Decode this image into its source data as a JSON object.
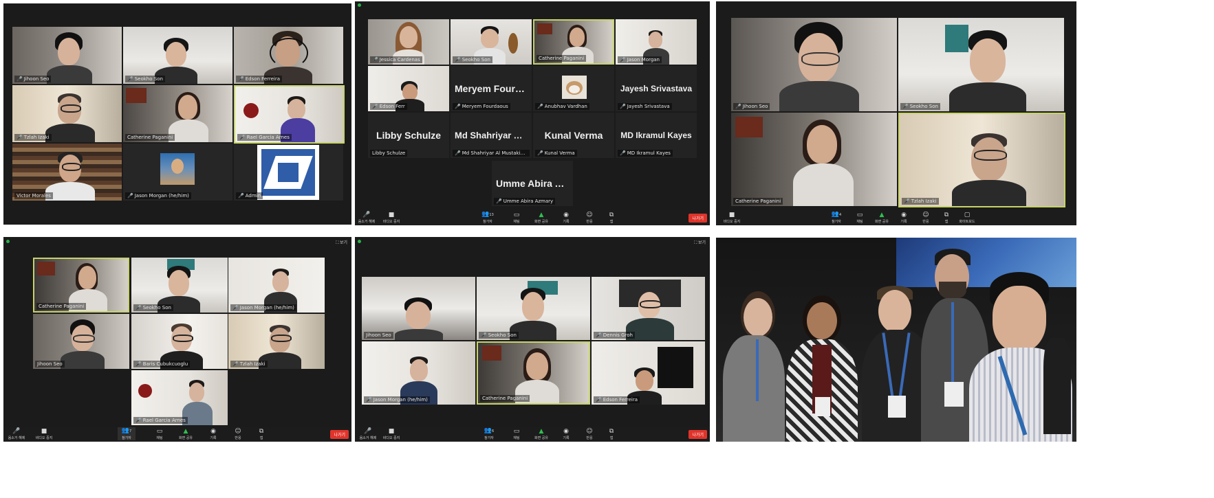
{
  "panels": {
    "p1": {
      "tiles": [
        {
          "name": "Jihoon Seo"
        },
        {
          "name": "Seokho Son"
        },
        {
          "name": "Edson Ferreira"
        },
        {
          "name": "Tzlah Izaki"
        },
        {
          "name": "Catherine Paganini"
        },
        {
          "name": "Rael Garcia Arnes"
        },
        {
          "name": "Victor Morales"
        },
        {
          "name": "Jason Morgan (he/him)"
        },
        {
          "name": "Admin"
        }
      ]
    },
    "p2": {
      "tiles": [
        {
          "name": "Jessica Cardenas",
          "big": ""
        },
        {
          "name": "Seokho Son",
          "big": ""
        },
        {
          "name": "Catherine Paganini",
          "big": ""
        },
        {
          "name": "Jason Morgan",
          "big": ""
        },
        {
          "name": "Edson Ferr",
          "big": ""
        },
        {
          "name": "Meryem Fourdaous",
          "big": "Meryem Fourda..."
        },
        {
          "name": "Anubhav Vardhan",
          "big": ""
        },
        {
          "name": "Jayesh Srivastava",
          "big": "Jayesh Srivastava"
        },
        {
          "name": "Libby Schulze",
          "big": "Libby Schulze"
        },
        {
          "name": "Md Shahriyar Al Mustakim Mitul",
          "big": "Md Shahriyar Al..."
        },
        {
          "name": "Kunal Verma",
          "big": "Kunal Verma"
        },
        {
          "name": "MD Ikramul Kayes",
          "big": "MD Ikramul Kayes"
        },
        {
          "name": "Umme Abira Azmary",
          "big": "Umme Abira Az..."
        }
      ],
      "toolbar": {
        "mute": "음소거 해제",
        "video": "비디오 중지",
        "participants": "참가자",
        "participants_count": "13",
        "chat": "채팅",
        "share": "화면 공유",
        "record": "기록",
        "reactions": "반응",
        "apps": "앱",
        "leave": "나가기"
      }
    },
    "p3": {
      "tiles": [
        {
          "name": "Jihoon Seo"
        },
        {
          "name": "Seokho Son"
        },
        {
          "name": "Catherine Paganini"
        },
        {
          "name": "Tzlah Izaki"
        }
      ],
      "toolbar": {
        "video": "비디오 중지",
        "participants": "참가자",
        "participants_count": "4",
        "chat": "채팅",
        "share": "화면 공유",
        "record": "기록",
        "reactions": "반응",
        "apps": "앱",
        "whiteboard": "화이트보드"
      }
    },
    "p4": {
      "tiles": [
        {
          "name": "Catherine Paganini"
        },
        {
          "name": "Seokho Son"
        },
        {
          "name": "Jason Morgan (he/him)"
        },
        {
          "name": "Jihoon Seo"
        },
        {
          "name": "Baris Cubukcuoglu"
        },
        {
          "name": "Tzlah Izaki"
        },
        {
          "name": "Rael Garcia Arnes"
        }
      ],
      "fullscreen": "보기",
      "toolbar": {
        "mute": "음소거 해제",
        "video": "비디오 중지",
        "participants": "참가자",
        "participants_count": "7",
        "chat": "채팅",
        "share": "화면 공유",
        "record": "기록",
        "reactions": "반응",
        "apps": "앱",
        "leave": "나가기"
      }
    },
    "p5": {
      "tiles": [
        {
          "name": "Jihoon Seo"
        },
        {
          "name": "Seokho Son"
        },
        {
          "name": "Dennis Groh"
        },
        {
          "name": "Jason Morgan (he/him)"
        },
        {
          "name": "Catherine Paganini"
        },
        {
          "name": "Edson Ferreira"
        }
      ],
      "fullscreen": "보기",
      "toolbar": {
        "mute": "음소거 해제",
        "video": "비디오 중지",
        "participants": "참가자",
        "participants_count": "6",
        "chat": "채팅",
        "share": "화면 공유",
        "record": "기록",
        "reactions": "반응",
        "apps": "앱",
        "leave": "나가기"
      }
    }
  }
}
